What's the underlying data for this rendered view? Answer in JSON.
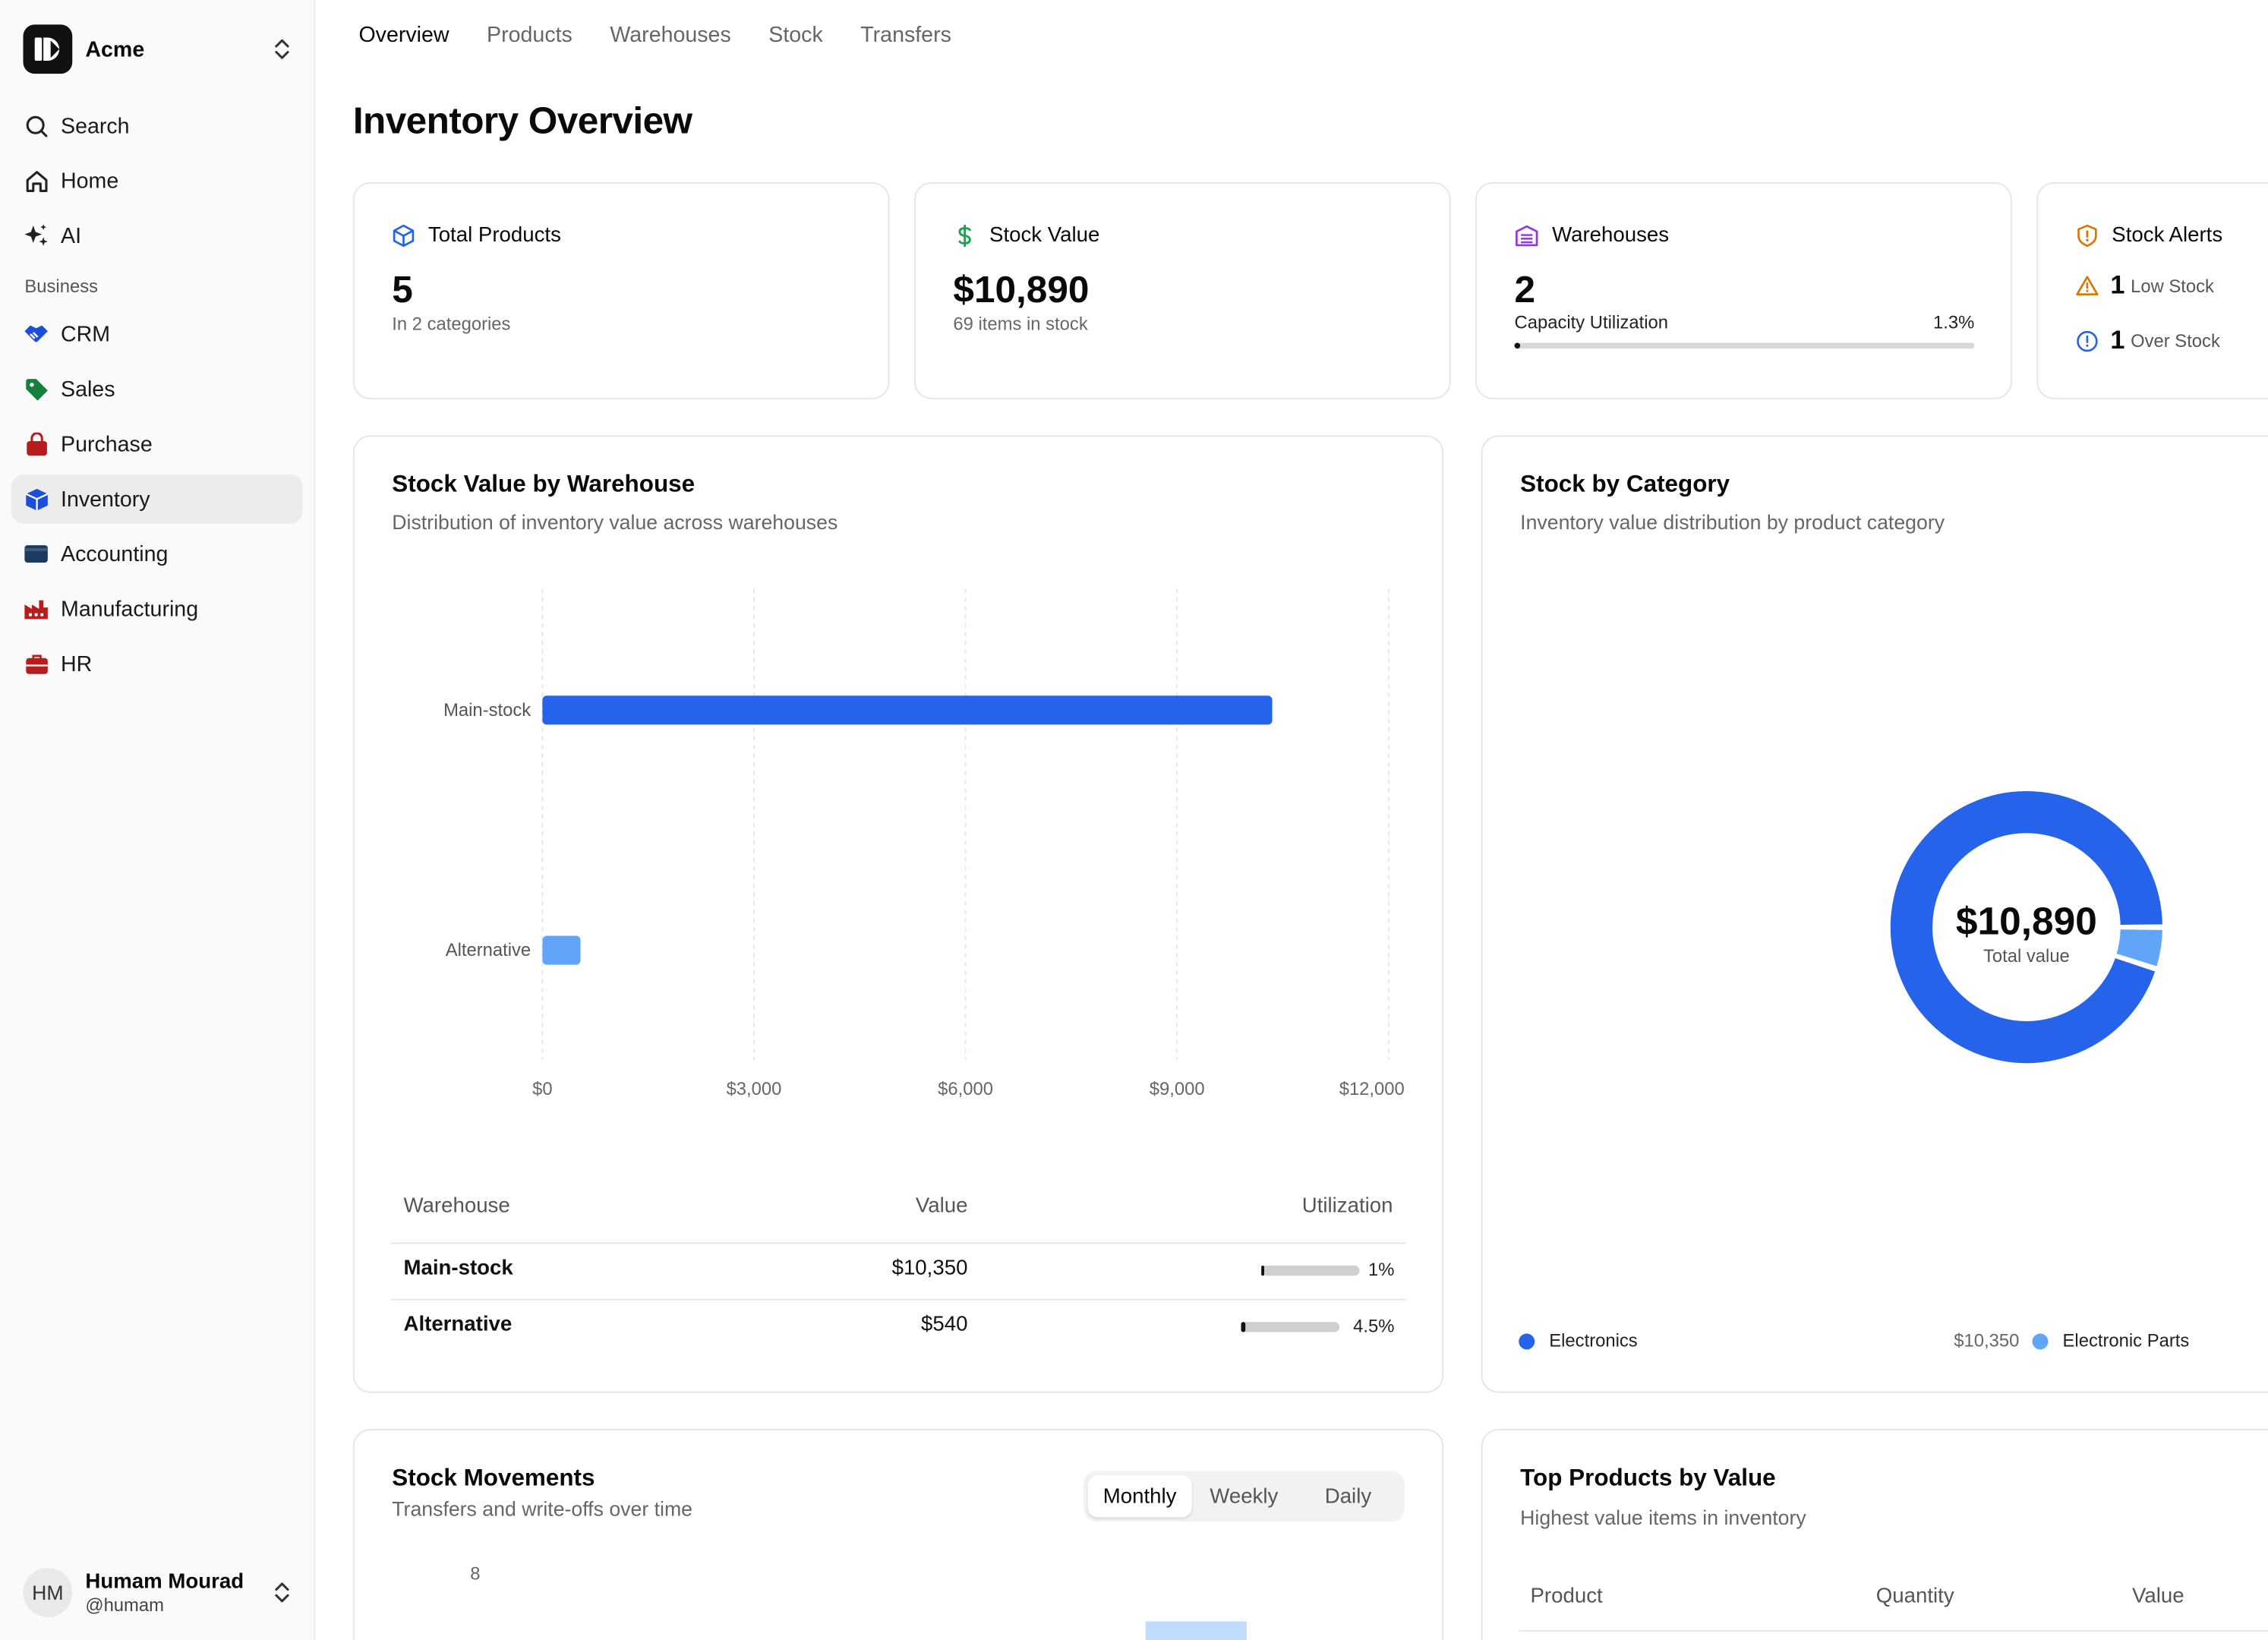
{
  "org": {
    "name": "Acme"
  },
  "nav": {
    "search": "Search",
    "home": "Home",
    "ai": "AI",
    "section": "Business",
    "items": [
      {
        "label": "CRM"
      },
      {
        "label": "Sales"
      },
      {
        "label": "Purchase"
      },
      {
        "label": "Inventory"
      },
      {
        "label": "Accounting"
      },
      {
        "label": "Manufacturing"
      },
      {
        "label": "HR"
      }
    ]
  },
  "user": {
    "initials": "HM",
    "name": "Humam Mourad",
    "handle": "@humam"
  },
  "tabs": [
    "Overview",
    "Products",
    "Warehouses",
    "Stock",
    "Transfers"
  ],
  "page": {
    "title": "Inventory Overview"
  },
  "kpis": {
    "total_products": {
      "label": "Total Products",
      "value": "5",
      "sub": "In 2 categories"
    },
    "stock_value": {
      "label": "Stock Value",
      "value": "$10,890",
      "sub": "69 items in stock"
    },
    "warehouses": {
      "label": "Warehouses",
      "value": "2",
      "capacity_label": "Capacity Utilization",
      "capacity_value": "1.3%",
      "capacity_fraction": 0.013
    },
    "alerts": {
      "label": "Stock Alerts",
      "low_count": "1",
      "low_label": "Low Stock",
      "over_count": "1",
      "over_label": "Over Stock"
    }
  },
  "warehouse_card": {
    "title": "Stock Value by Warehouse",
    "subtitle": "Distribution of inventory value across warehouses",
    "table": {
      "headers": {
        "warehouse": "Warehouse",
        "value": "Value",
        "utilization": "Utilization"
      },
      "rows": [
        {
          "name": "Main-stock",
          "value": "$10,350",
          "util_label": "1%",
          "util": 0.01
        },
        {
          "name": "Alternative",
          "value": "$540",
          "util_label": "4.5%",
          "util": 0.045
        }
      ]
    }
  },
  "category_card": {
    "title": "Stock by Category",
    "subtitle": "Inventory value distribution by product category",
    "center_value": "$10,890",
    "center_label": "Total value",
    "legend": [
      {
        "name": "Electronics",
        "value": "$10,350"
      },
      {
        "name": "Electronic Parts"
      }
    ]
  },
  "movements_card": {
    "title": "Stock Movements",
    "subtitle": "Transfers and write-offs over time",
    "periods": [
      "Monthly",
      "Weekly",
      "Daily"
    ],
    "y_tick_top": "8"
  },
  "top_products_card": {
    "title": "Top Products by Value",
    "subtitle": "Highest value items in inventory",
    "headers": {
      "product": "Product",
      "quantity": "Quantity",
      "value": "Value"
    }
  },
  "colors": {
    "primary": "#2563eb",
    "secondary": "#60a5fa",
    "purple": "#9333ea",
    "green": "#16a34a",
    "amber": "#d97706",
    "blue_alert": "#2563eb"
  },
  "chart_data": [
    {
      "type": "bar",
      "orientation": "horizontal",
      "categories": [
        "Main-stock",
        "Alternative"
      ],
      "values": [
        10350,
        540
      ],
      "xlim": [
        0,
        12000
      ],
      "x_ticks": [
        "$0",
        "$3,000",
        "$6,000",
        "$9,000",
        "$12,000"
      ],
      "x_tick_values": [
        0,
        3000,
        6000,
        9000,
        12000
      ],
      "grid": "vertical dashed"
    },
    {
      "type": "pie",
      "donut": true,
      "categories": [
        "Electronics",
        "Electronic Parts"
      ],
      "values": [
        10350,
        540
      ]
    }
  ]
}
